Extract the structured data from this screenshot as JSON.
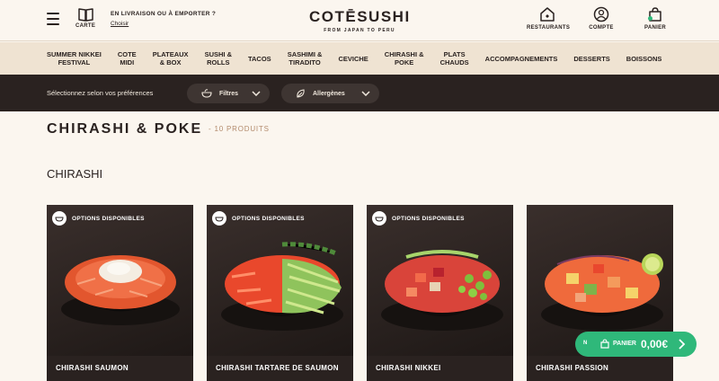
{
  "header": {
    "carte_label": "CARTE",
    "delivery_text": "EN LIVRAISON OU À EMPORTER ?",
    "delivery_link": "Choisir",
    "logo_name": "COTĒSUSHI",
    "logo_tagline": "FROM JAPAN TO PERU",
    "icons": [
      {
        "label": "RESTAURANTS",
        "icon": "house-icon"
      },
      {
        "label": "COMPTE",
        "icon": "user-icon"
      },
      {
        "label": "PANIER",
        "icon": "bag-icon"
      }
    ]
  },
  "categories": [
    [
      "SUMMER NIKKEI",
      "FESTIVAL"
    ],
    [
      "COTE",
      "MIDI"
    ],
    [
      "PLATEAUX",
      "& BOX"
    ],
    [
      "SUSHI &",
      "ROLLS"
    ],
    [
      "TACOS"
    ],
    [
      "SASHIMI &",
      "TIRADITO"
    ],
    [
      "CEVICHE"
    ],
    [
      "CHIRASHI &",
      "POKE"
    ],
    [
      "PLATS",
      "CHAUDS"
    ],
    [
      "ACCOMPAGNEMENTS"
    ],
    [
      "DESSERTS"
    ],
    [
      "BOISSONS"
    ]
  ],
  "filter_bar": {
    "lead": "Sélectionnez selon vos préférences",
    "filters_label": "Filtres",
    "allergens_label": "Allergènes"
  },
  "page": {
    "title": "CHIRASHI & POKE",
    "count": "- 10 PRODUITS",
    "section": "CHIRASHI"
  },
  "products": [
    {
      "name": "CHIRASHI SAUMON",
      "options": "OPTIONS DISPONIBLES"
    },
    {
      "name": "CHIRASHI TARTARE DE SAUMON",
      "options": "OPTIONS DISPONIBLES"
    },
    {
      "name": "CHIRASHI NIKKEI",
      "options": "OPTIONS DISPONIBLES"
    },
    {
      "name": "CHIRASHI PASSION",
      "options": ""
    }
  ],
  "floating_cart": {
    "badge": "N",
    "label": "PANIER",
    "amount": "0,00€"
  },
  "colors": {
    "background": "#fbf6ef",
    "nav_background": "#efe3d2",
    "filter_bar": "#2a2220",
    "accent_green": "#2fb87a",
    "count_text": "#b38b6d"
  }
}
